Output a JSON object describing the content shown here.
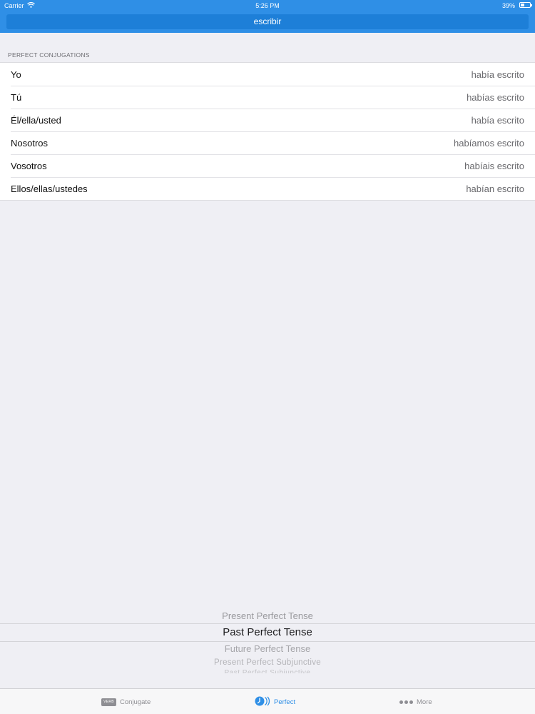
{
  "status_bar": {
    "carrier": "Carrier",
    "time": "5:26 PM",
    "battery": "39%",
    "battery_level": 0.39
  },
  "verb_field": {
    "value": "escribir"
  },
  "section": {
    "header": "PERFECT CONJUGATIONS",
    "rows": [
      {
        "pronoun": "Yo",
        "form": "había escrito"
      },
      {
        "pronoun": "Tú",
        "form": "habías escrito"
      },
      {
        "pronoun": "Él/ella/usted",
        "form": "había escrito"
      },
      {
        "pronoun": "Nosotros",
        "form": "habíamos escrito"
      },
      {
        "pronoun": "Vosotros",
        "form": "habíais escrito"
      },
      {
        "pronoun": "Ellos/ellas/ustedes",
        "form": "habían escrito"
      }
    ]
  },
  "tense_picker": {
    "options": [
      "Present Perfect Tense",
      "Past Perfect Tense",
      "Future Perfect Tense",
      "Present Perfect Subjunctive",
      "Past Perfect Subjunctive"
    ],
    "selected": "Past Perfect Tense"
  },
  "tab_bar": {
    "conjugate": {
      "label": "Conjugate",
      "icon": "verb-icon",
      "icon_text": "VERB"
    },
    "perfect": {
      "label": "Perfect",
      "icon": "perfect-icon"
    },
    "more": {
      "label": "More",
      "icon": "more-dots-icon"
    }
  },
  "colors": {
    "accent": "#2f8fe6",
    "verb_bar": "#1d7fd8",
    "background": "#efeff4"
  }
}
